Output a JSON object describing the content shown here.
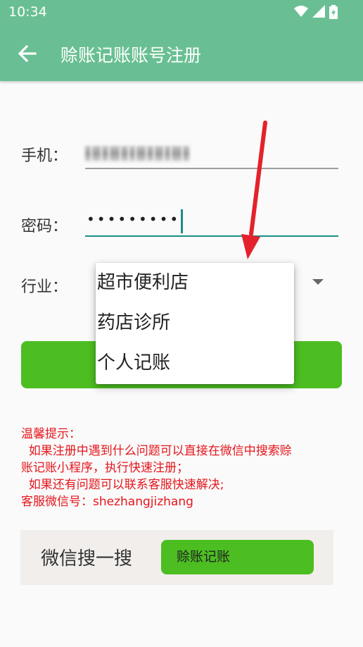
{
  "status_bar": {
    "time": "10:34",
    "icons": [
      "wifi-icon",
      "signal-icon",
      "battery-icon"
    ]
  },
  "app_bar": {
    "title": "赊账记账账号注册",
    "back_icon": "back-arrow-icon"
  },
  "form": {
    "phone_label": "手机：",
    "phone_value_redacted": true,
    "password_label": "密码：",
    "password_value": "•••••••••",
    "industry_label": "行业："
  },
  "industry_dropdown": {
    "options": [
      "超市便利店",
      "药店诊所",
      "个人记账"
    ]
  },
  "tip": {
    "title": "温馨提示：",
    "lines": [
      "  如果注册中遇到什么问题可以直接在微信中搜索赊",
      "账记账小程序，执行快速注册；",
      "  如果还有问题可以联系客服快速解决;",
      "客服微信号：shezhangjizhang"
    ]
  },
  "wechat_search": {
    "label": "微信搜一搜",
    "button_label": "赊账记账"
  },
  "colors": {
    "primary": "#69bf93",
    "accent_green": "#4cbe22",
    "tip_red": "#e5161c",
    "annotation_red": "#e3222b",
    "underline_active": "#1a8d86"
  }
}
